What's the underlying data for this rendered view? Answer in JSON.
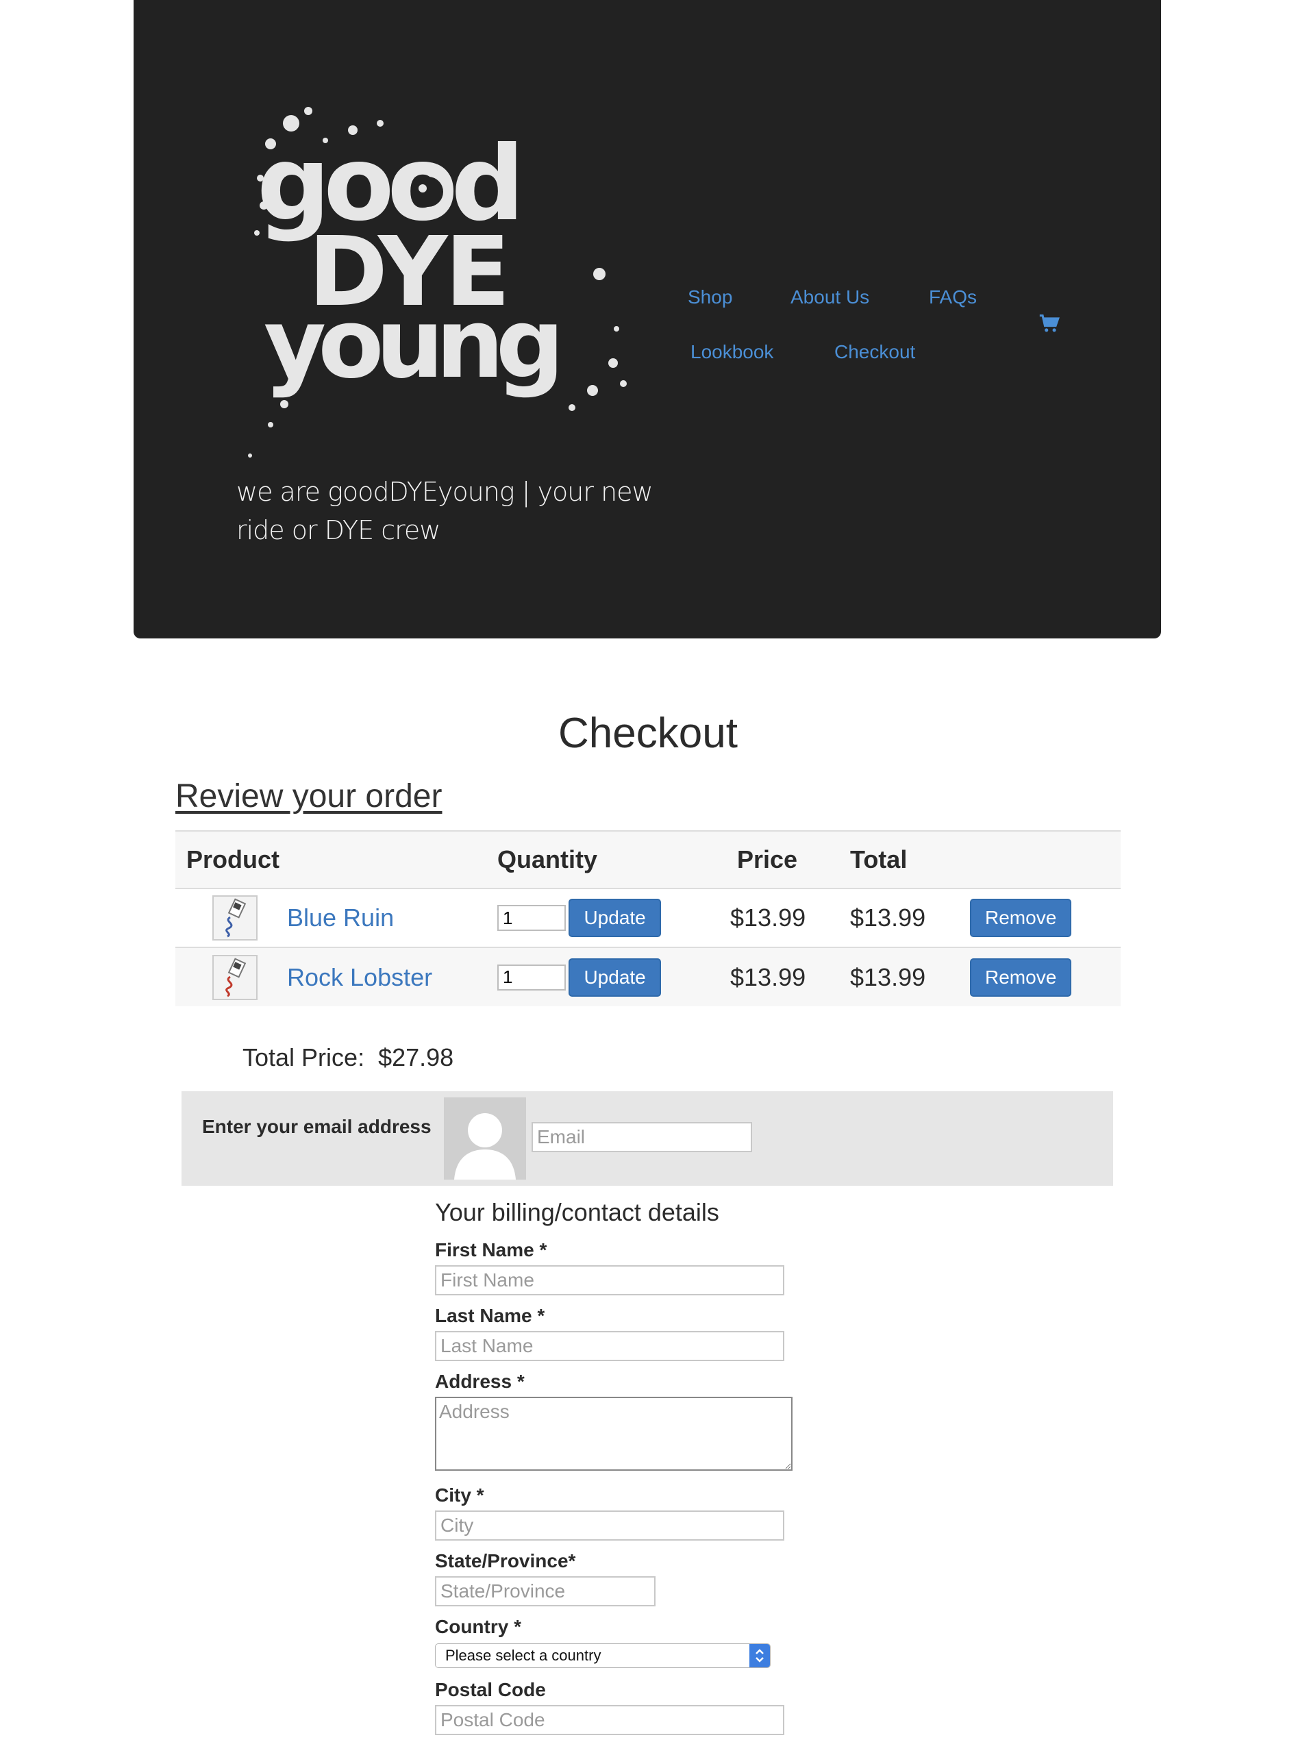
{
  "header": {
    "logo_text": [
      "good",
      "DYE",
      "young"
    ],
    "tagline_line1": "we are goodDYEyoung | your new",
    "tagline_line2": "ride or DYE crew",
    "nav": {
      "shop": "Shop",
      "about": "About Us",
      "faqs": "FAQs",
      "lookbook": "Lookbook",
      "checkout": "Checkout"
    },
    "cart_icon": "shopping-cart-icon"
  },
  "page": {
    "title": "Checkout",
    "review_title": "Review your order"
  },
  "cart": {
    "columns": [
      "Product",
      "Quantity",
      "Price",
      "Total"
    ],
    "items": [
      {
        "name": "Blue Ruin",
        "quantity": "1",
        "price": "$13.99",
        "total": "$13.99",
        "update_label": "Update",
        "remove_label": "Remove"
      },
      {
        "name": "Rock Lobster",
        "quantity": "1",
        "price": "$13.99",
        "total": "$13.99",
        "update_label": "Update",
        "remove_label": "Remove"
      }
    ],
    "total_label": "Total Price:",
    "total_value": "$27.98"
  },
  "email": {
    "label": "Enter your email address",
    "placeholder": "Email"
  },
  "billing": {
    "title": "Your billing/contact details",
    "first_name_label": "First Name *",
    "first_name_placeholder": "First Name",
    "last_name_label": "Last Name *",
    "last_name_placeholder": "Last Name",
    "address_label": "Address *",
    "address_placeholder": "Address",
    "city_label": "City *",
    "city_placeholder": "City",
    "state_label": "State/Province*",
    "state_placeholder": "State/Province",
    "country_label": "Country *",
    "country_selected": "Please select a country",
    "postal_label": "Postal Code",
    "postal_placeholder": "Postal Code"
  },
  "colors": {
    "header_bg": "#222222",
    "link": "#4b8fd6",
    "button": "#3c78be",
    "band": "#e6e6e6"
  }
}
